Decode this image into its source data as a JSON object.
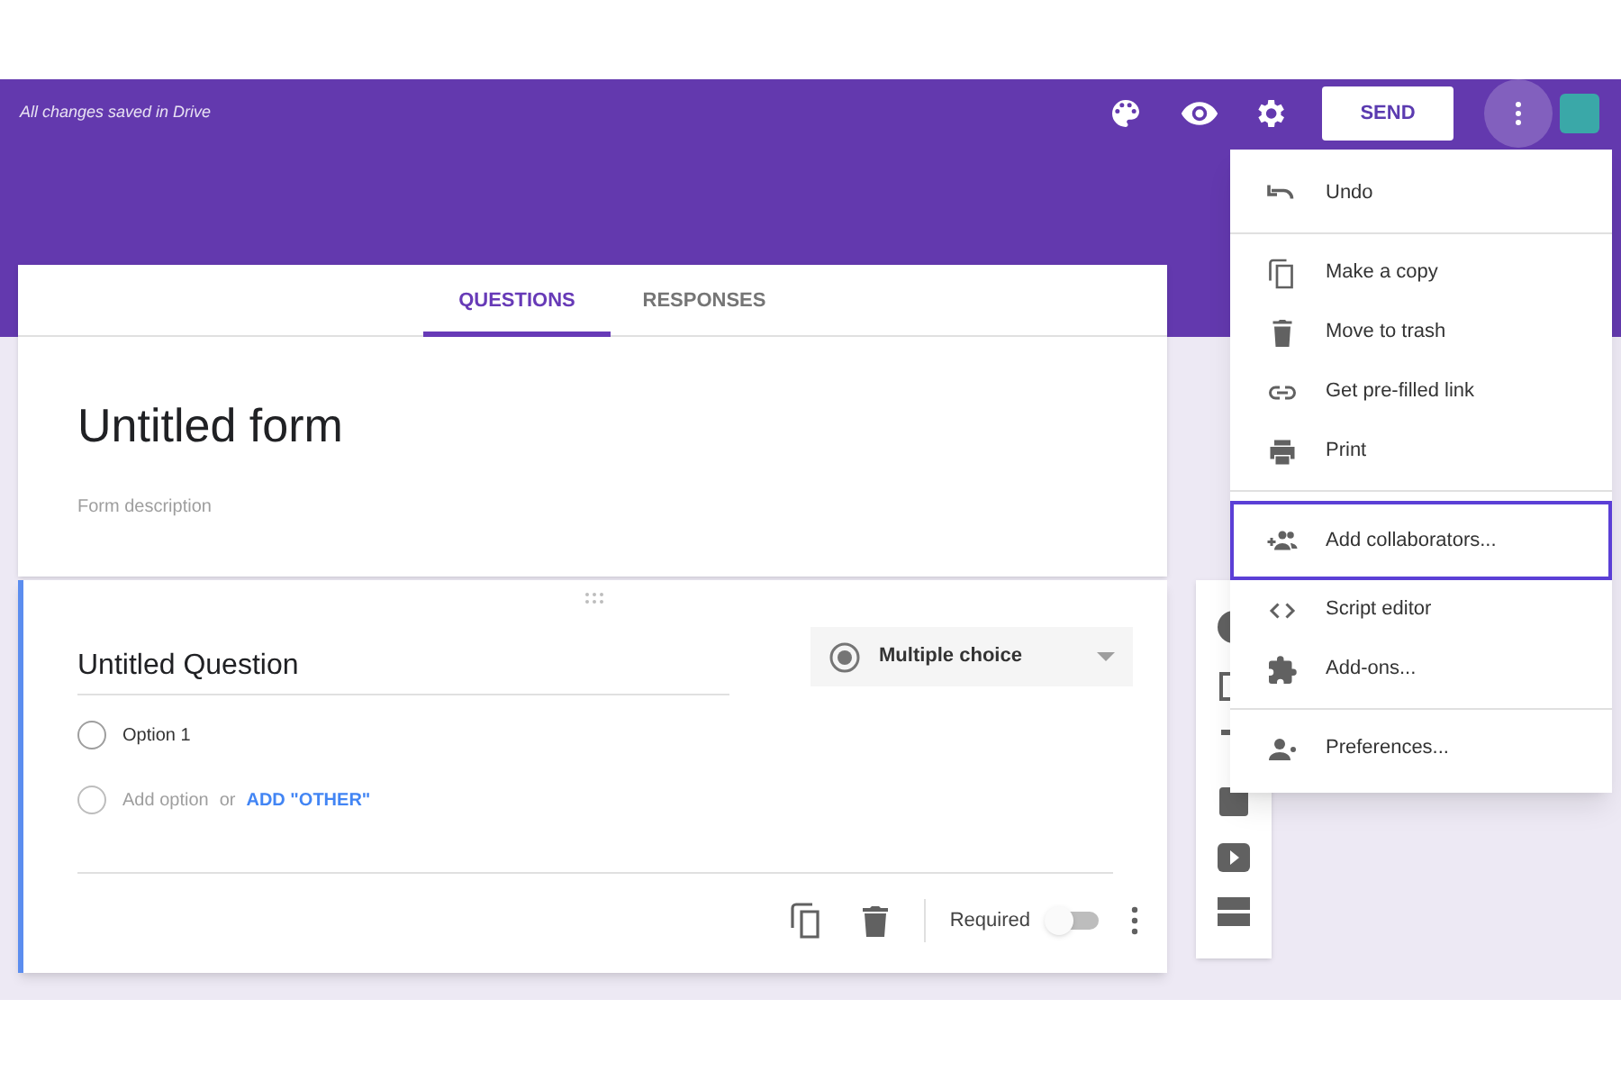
{
  "header": {
    "status": "All changes saved in Drive",
    "send_button": "SEND"
  },
  "tabs": [
    {
      "label": "QUESTIONS",
      "selected": true
    },
    {
      "label": "RESPONSES",
      "selected": false
    }
  ],
  "form": {
    "title": "Untitled form",
    "description_placeholder": "Form description"
  },
  "question": {
    "title": "Untitled Question",
    "type": "Multiple choice",
    "options": [
      {
        "label": "Option 1"
      }
    ],
    "add_option": "Add option",
    "or": "or",
    "add_other": "ADD \"OTHER\"",
    "required_label": "Required",
    "required": false
  },
  "menu": {
    "groups": [
      [
        {
          "label": "Undo",
          "selected": false
        }
      ],
      [
        {
          "label": "Make a copy",
          "selected": false
        },
        {
          "label": "Move to trash",
          "selected": false
        },
        {
          "label": "Get pre-filled link",
          "selected": false
        },
        {
          "label": "Print",
          "selected": false
        }
      ],
      [
        {
          "label": "Add collaborators...",
          "selected": true
        },
        {
          "label": "Script editor",
          "selected": false
        },
        {
          "label": "Add-ons...",
          "selected": false
        }
      ],
      [
        {
          "label": "Preferences...",
          "selected": false
        }
      ]
    ]
  }
}
